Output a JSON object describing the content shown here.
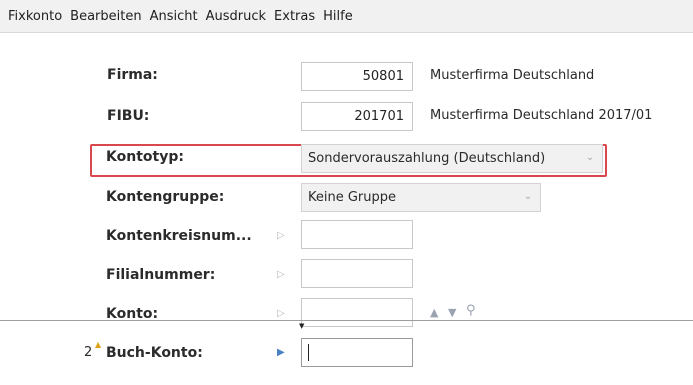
{
  "menu": [
    "Fixkonto",
    "Bearbeiten",
    "Ansicht",
    "Ausdruck",
    "Extras",
    "Hilfe"
  ],
  "form": {
    "firma": {
      "label": "Firma:",
      "value": "50801",
      "description": "Musterfirma Deutschland"
    },
    "fibu": {
      "label": "FIBU:",
      "value": "201701",
      "description": "Musterfirma Deutschland 2017/01"
    },
    "kontotyp": {
      "label": "Kontotyp:",
      "selected": "Sondervorauszahlung (Deutschland)"
    },
    "kontengruppe": {
      "label": "Kontengruppe:",
      "selected": "Keine Gruppe"
    },
    "kontenkreisnummer": {
      "label": "Kontenkreisnum...",
      "value": ""
    },
    "filialnummer": {
      "label": "Filialnummer:",
      "value": ""
    },
    "konto": {
      "label": "Konto:",
      "value": ""
    }
  },
  "bottom": {
    "number": "2",
    "label": "Buch-Konto:",
    "value": ""
  },
  "colors": {
    "highlight": "#d9474f",
    "menubar": "#f1f1f1"
  }
}
